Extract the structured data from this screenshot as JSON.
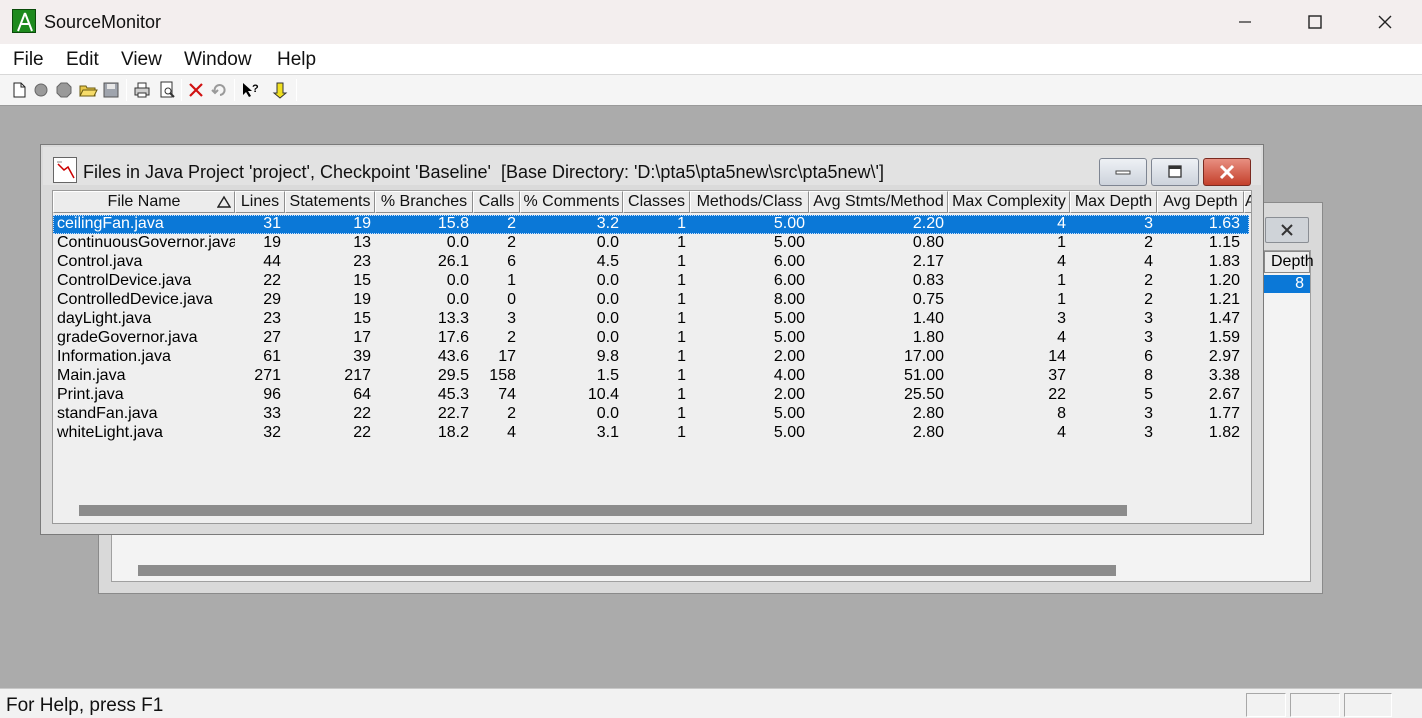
{
  "app": {
    "title": "SourceMonitor"
  },
  "menu": [
    {
      "label": "File"
    },
    {
      "label": "Edit"
    },
    {
      "label": "View"
    },
    {
      "label": "Window"
    },
    {
      "label": "Help"
    }
  ],
  "toolbar": {
    "buttons": [
      "new-file-icon",
      "open-checkpoint-icon",
      "stop-icon",
      "open-folder-icon",
      "save-icon",
      "print-icon",
      "print-preview-icon",
      "delete-icon",
      "undo-icon",
      "context-help-icon",
      "export-icon"
    ]
  },
  "back_window": {
    "header_partial": "Depth",
    "selected_value": "8"
  },
  "front_window": {
    "title": "Files in Java Project 'project', Checkpoint 'Baseline'  [Base Directory: 'D:\\pta5\\pta5new\\src\\pta5new\\']",
    "columns": [
      "File Name",
      "Lines",
      "Statements",
      "% Branches",
      "Calls",
      "% Comments",
      "Classes",
      "Methods/Class",
      "Avg Stmts/Method",
      "Max Complexity",
      "Max Depth",
      "Avg Depth",
      "A"
    ],
    "rows": [
      [
        "ceilingFan.java",
        "31",
        "19",
        "15.8",
        "2",
        "3.2",
        "1",
        "5.00",
        "2.20",
        "4",
        "3",
        "1.63"
      ],
      [
        "ContinuousGovernor.java",
        "19",
        "13",
        "0.0",
        "2",
        "0.0",
        "1",
        "5.00",
        "0.80",
        "1",
        "2",
        "1.15"
      ],
      [
        "Control.java",
        "44",
        "23",
        "26.1",
        "6",
        "4.5",
        "1",
        "6.00",
        "2.17",
        "4",
        "4",
        "1.83"
      ],
      [
        "ControlDevice.java",
        "22",
        "15",
        "0.0",
        "1",
        "0.0",
        "1",
        "6.00",
        "0.83",
        "1",
        "2",
        "1.20"
      ],
      [
        "ControlledDevice.java",
        "29",
        "19",
        "0.0",
        "0",
        "0.0",
        "1",
        "8.00",
        "0.75",
        "1",
        "2",
        "1.21"
      ],
      [
        "dayLight.java",
        "23",
        "15",
        "13.3",
        "3",
        "0.0",
        "1",
        "5.00",
        "1.40",
        "3",
        "3",
        "1.47"
      ],
      [
        "gradeGovernor.java",
        "27",
        "17",
        "17.6",
        "2",
        "0.0",
        "1",
        "5.00",
        "1.80",
        "4",
        "3",
        "1.59"
      ],
      [
        "Information.java",
        "61",
        "39",
        "43.6",
        "17",
        "9.8",
        "1",
        "2.00",
        "17.00",
        "14",
        "6",
        "2.97"
      ],
      [
        "Main.java",
        "271",
        "217",
        "29.5",
        "158",
        "1.5",
        "1",
        "4.00",
        "51.00",
        "37",
        "8",
        "3.38"
      ],
      [
        "Print.java",
        "96",
        "64",
        "45.3",
        "74",
        "10.4",
        "1",
        "2.00",
        "25.50",
        "22",
        "5",
        "2.67"
      ],
      [
        "standFan.java",
        "33",
        "22",
        "22.7",
        "2",
        "0.0",
        "1",
        "5.00",
        "2.80",
        "8",
        "3",
        "1.77"
      ],
      [
        "whiteLight.java",
        "32",
        "22",
        "18.2",
        "4",
        "3.1",
        "1",
        "5.00",
        "2.80",
        "4",
        "3",
        "1.82"
      ]
    ],
    "selected_row": 0
  },
  "status": {
    "text": "For Help, press F1"
  }
}
